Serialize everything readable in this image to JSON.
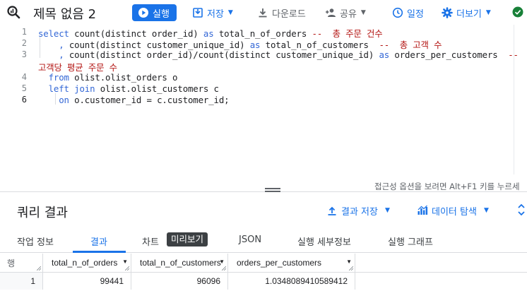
{
  "toolbar": {
    "title": "제목 없음 2",
    "run_label": "실행",
    "save_label": "저장",
    "download_label": "다운로드",
    "share_label": "공유",
    "schedule_label": "일정",
    "more_label": "더보기"
  },
  "editor": {
    "line_numbers": [
      "1",
      "2",
      "3",
      "4",
      "5",
      "6"
    ],
    "lines": [
      {
        "kw1": "select",
        "t1": " count(distinct order_id) ",
        "kw2": "as",
        "t2": " total_n_of_orders ",
        "cm": "--  총 주문 건수"
      },
      {
        "kw1": "    , ",
        "t1": "count(distinct customer_unique_id) ",
        "kw2": "as",
        "t2": " total_n_of_customers  ",
        "cm": "--  총 고객 수"
      },
      {
        "kw1": "    , ",
        "t1": "count(distinct order_id)/count(distinct customer_unique_id) ",
        "kw2": "as",
        "t2": " orders_per_customers  ",
        "cm": "--"
      },
      {
        "cm": "고객당 평균 주문 수"
      },
      {
        "kw1": "  from",
        "t1": " olist.olist_orders o"
      },
      {
        "kw1": "  left join",
        "t1": " olist.olist_customers c"
      },
      {
        "kw1": "    on",
        "t1": " o.customer_id = c.customer_id;"
      }
    ],
    "accessibility_hint": "접근성 옵션을 보려면 Alt+F1 키를 누르세"
  },
  "results": {
    "title": "쿼리 결과",
    "save_results_label": "결과 저장",
    "explore_data_label": "데이터 탐색"
  },
  "tabs": [
    {
      "label": "작업 정보"
    },
    {
      "label": "결과"
    },
    {
      "label": "차트"
    },
    {
      "label": "JSON"
    },
    {
      "label": "실행 세부정보"
    },
    {
      "label": "실행 그래프"
    }
  ],
  "preview_badge": "미리보기",
  "table": {
    "row_header": "행",
    "columns": [
      "total_n_of_orders",
      "total_n_of_customers",
      "orders_per_customers"
    ],
    "rows": [
      {
        "row": "1",
        "cells": [
          "99441",
          "96096",
          "1.0348089410589412"
        ]
      }
    ]
  },
  "colors": {
    "accent": "#1a73e8",
    "keyword": "#3367d6",
    "comment": "#b31412",
    "success": "#188038"
  }
}
